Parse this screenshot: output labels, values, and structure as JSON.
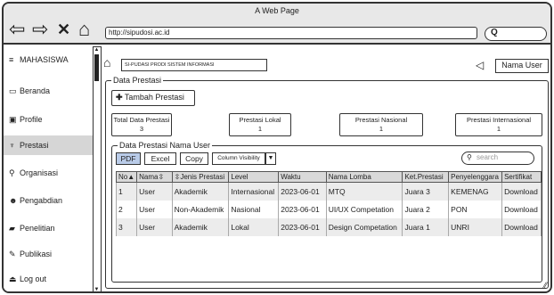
{
  "window": {
    "title": "A Web Page",
    "url": "http://sipudosi.ac.id"
  },
  "sidebar": {
    "header": {
      "label": "MAHASISWA",
      "icon": "menu-icon"
    },
    "items": [
      {
        "label": "Beranda",
        "icon": "monitor-icon"
      },
      {
        "label": "Profile",
        "icon": "id-card-icon"
      },
      {
        "label": "Prestasi",
        "icon": "trophy-icon",
        "active": true
      },
      {
        "label": "Organisasi",
        "icon": "org-icon"
      },
      {
        "label": "Pengabdian",
        "icon": "people-icon"
      },
      {
        "label": "Penelitian",
        "icon": "book-icon"
      },
      {
        "label": "Publikasi",
        "icon": "pen-icon"
      },
      {
        "label": "Log out",
        "icon": "logout-icon"
      }
    ]
  },
  "header": {
    "brand": "SI-PUDASI PRODI SISTEM INFORMASI",
    "user": "Nama User"
  },
  "prestasi": {
    "group_title": "Data Prestasi",
    "add_label": "Tambah Prestasi",
    "stats": [
      {
        "label": "Total Data Prestasi",
        "value": "3"
      },
      {
        "label": "Prestasi Lokal",
        "value": "1"
      },
      {
        "label": "Prestasi Nasional",
        "value": "1"
      },
      {
        "label": "Prestasi Internasional",
        "value": "1"
      }
    ]
  },
  "table_section": {
    "title": "Data Prestasi Nama User",
    "buttons": {
      "pdf": "PDF",
      "excel": "Excel",
      "copy": "Copy",
      "colvis": "Column Visibility"
    },
    "search_placeholder": "search",
    "columns": [
      "No",
      "Nama",
      "Jenis Prestasi",
      "Level",
      "Waktu",
      "Nama Lomba",
      "Ket.Prestasi",
      "Penyelenggara",
      "Sertifikat"
    ],
    "rows": [
      [
        "1",
        "User",
        "Akademik",
        "Internasional",
        "2023-06-01",
        "MTQ",
        "Juara 3",
        "KEMENAG",
        "Download"
      ],
      [
        "2",
        "User",
        "Non-Akademik",
        "Nasional",
        "2023-06-01",
        "UI/UX Competation",
        "Juara 2",
        "PON",
        "Download"
      ],
      [
        "3",
        "User",
        "Akademik",
        "Lokal",
        "2023-06-01",
        "Design Competation",
        "Juara 1",
        "UNRI",
        "Download"
      ]
    ]
  }
}
